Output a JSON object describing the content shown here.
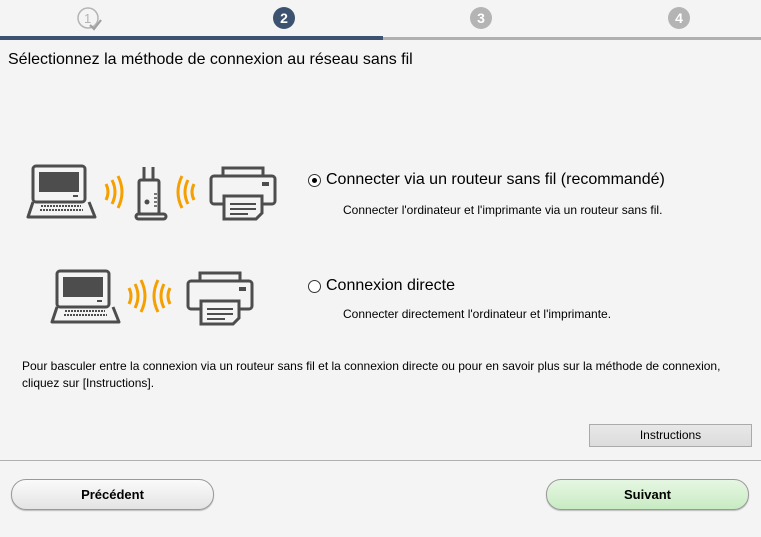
{
  "steps": {
    "items": [
      "1",
      "2",
      "3",
      "4"
    ],
    "current": 2,
    "progress_color": "#3d5270",
    "done_color": "#b0b0b0",
    "pending_color": "#b4b4b4"
  },
  "title": "Sélectionnez la méthode de connexion au réseau sans fil",
  "options": [
    {
      "label": "Connecter via un routeur sans fil (recommandé)",
      "description": "Connecter l'ordinateur et l'imprimante via un routeur sans fil.",
      "selected": true,
      "icons": [
        "laptop-icon",
        "wifi-waves-icon",
        "router-icon",
        "wifi-waves-icon",
        "printer-icon"
      ]
    },
    {
      "label": "Connexion directe",
      "description": "Connecter directement l'ordinateur et l'imprimante.",
      "selected": false,
      "icons": [
        "laptop-icon",
        "wifi-waves-icon",
        "wifi-waves-icon",
        "printer-icon"
      ]
    }
  ],
  "note": "Pour basculer entre la connexion via un routeur sans fil et la connexion directe ou pour en savoir plus sur la méthode de connexion, cliquez sur [Instructions].",
  "buttons": {
    "instructions": "Instructions",
    "back": "Précédent",
    "next": "Suivant"
  },
  "colors": {
    "wave": "#f5a000",
    "icon": "#4d4d4d",
    "next_button": "#d4f0d0"
  }
}
